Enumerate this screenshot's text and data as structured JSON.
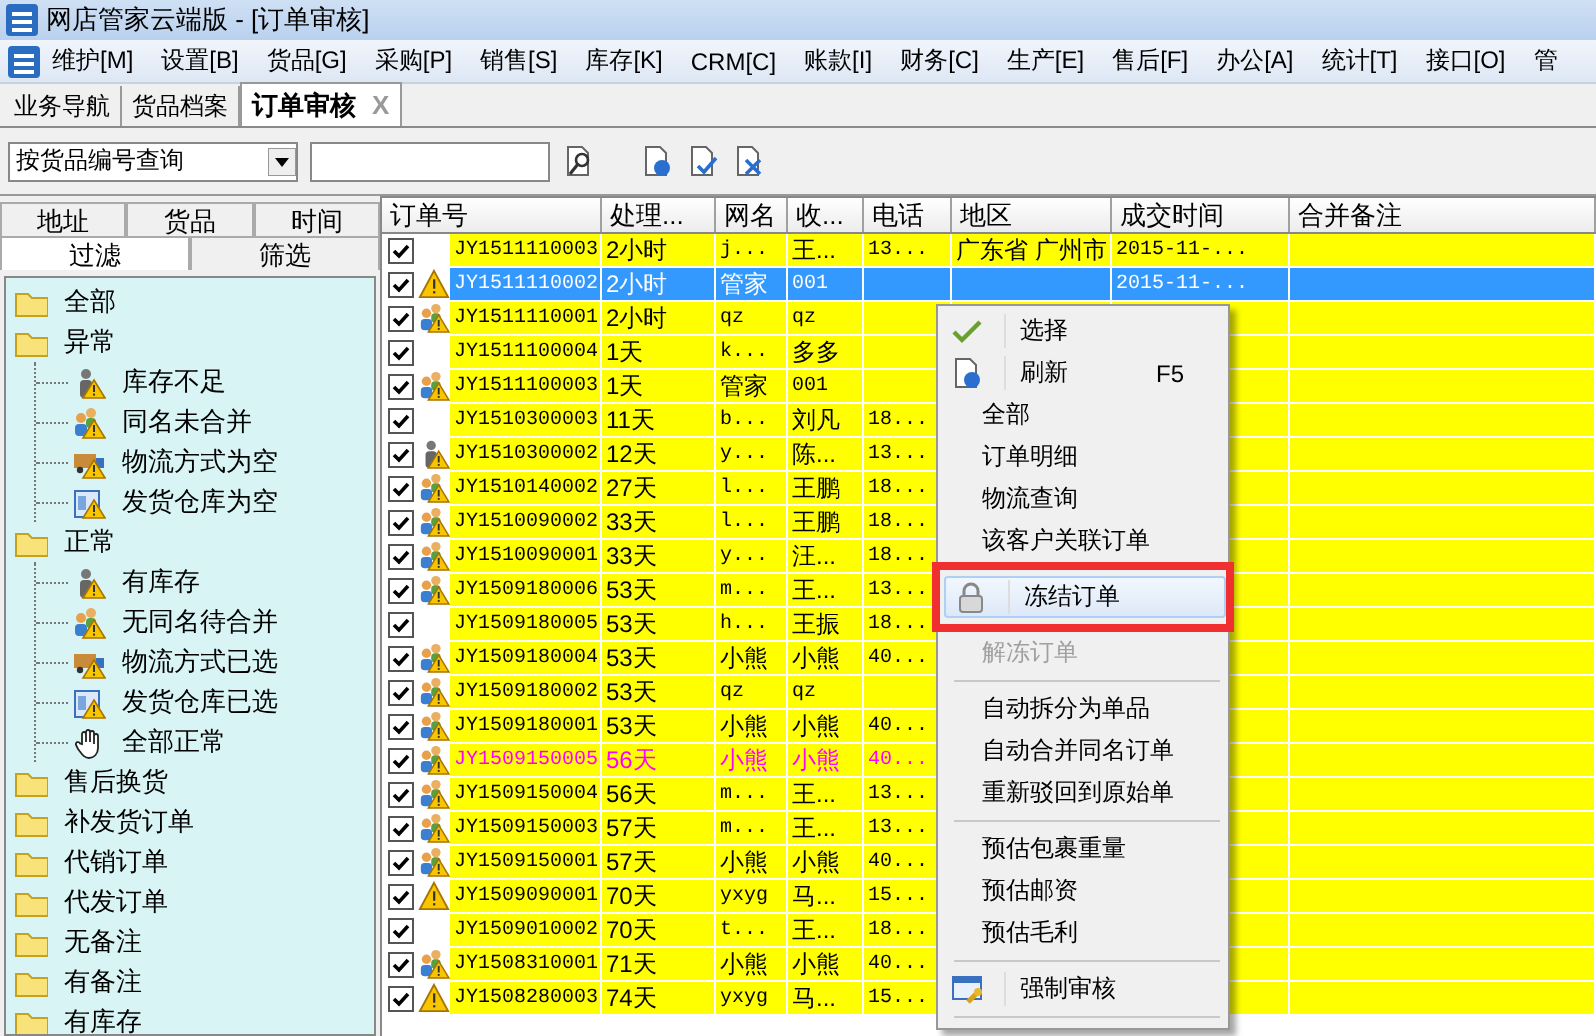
{
  "window": {
    "title": "网店管家云端版 - [订单审核]"
  },
  "menu_bar": [
    "维护[M]",
    "设置[B]",
    "货品[G]",
    "采购[P]",
    "销售[S]",
    "库存[K]",
    "CRM[C]",
    "账款[I]",
    "财务[C]",
    "生产[E]",
    "售后[F]",
    "办公[A]",
    "统计[T]",
    "接口[O]",
    "管"
  ],
  "doc_tabs": [
    {
      "label": "业务导航",
      "selected": false
    },
    {
      "label": "货品档案",
      "selected": false
    },
    {
      "label": "订单审核",
      "selected": true,
      "close": "X"
    }
  ],
  "toolbar": {
    "query_mode": "按货品编号查询"
  },
  "filter_panel": {
    "tab_rows": [
      [
        {
          "label": "地址",
          "selected": false
        },
        {
          "label": "货品",
          "selected": false
        },
        {
          "label": "时间",
          "selected": false
        }
      ],
      [
        {
          "label": "过滤",
          "selected": true
        },
        {
          "label": "筛选",
          "selected": false
        }
      ]
    ],
    "tree": [
      {
        "label": "全部",
        "kind": "folder"
      },
      {
        "label": "异常",
        "kind": "folder",
        "children": [
          {
            "label": "库存不足",
            "kind": "stock"
          },
          {
            "label": "同名未合并",
            "kind": "people"
          },
          {
            "label": "物流方式为空",
            "kind": "truck"
          },
          {
            "label": "发货仓库为空",
            "kind": "warehouse"
          }
        ]
      },
      {
        "label": "正常",
        "kind": "folder",
        "children": [
          {
            "label": "有库存",
            "kind": "stock"
          },
          {
            "label": "无同名待合并",
            "kind": "people"
          },
          {
            "label": "物流方式已选",
            "kind": "truck"
          },
          {
            "label": "发货仓库已选",
            "kind": "warehouse"
          },
          {
            "label": "全部正常",
            "kind": "hand"
          }
        ]
      },
      {
        "label": "售后换货",
        "kind": "folder"
      },
      {
        "label": "补发货订单",
        "kind": "folder"
      },
      {
        "label": "代销订单",
        "kind": "folder"
      },
      {
        "label": "代发订单",
        "kind": "folder"
      },
      {
        "label": "无备注",
        "kind": "folder"
      },
      {
        "label": "有备注",
        "kind": "folder"
      },
      {
        "label": "有库存",
        "kind": "folder"
      }
    ]
  },
  "grid": {
    "columns": [
      "订单号",
      "处理...",
      "网名",
      "收...",
      "电话",
      "地区",
      "成交时间",
      "合并备注"
    ],
    "rows": [
      {
        "checked": true,
        "kind": "plain",
        "order_no": "JY1511110003",
        "wait": "2小时",
        "nick": "j...",
        "receiver": "王...",
        "phone": "13...",
        "region": "广东省 广州市",
        "deal_time": "2015-11-...",
        "selected": false,
        "flagged": false
      },
      {
        "checked": true,
        "kind": "warning",
        "order_no": "JY1511110002",
        "wait": "2小时",
        "nick": "管家",
        "receiver": "001",
        "deal_time": "2015-11-...",
        "selected": true,
        "flagged": false
      },
      {
        "checked": true,
        "kind": "people",
        "order_no": "JY1511110001",
        "wait": "2小时",
        "nick": "qz",
        "receiver": "qz",
        "selected": false,
        "flagged": false
      },
      {
        "checked": true,
        "kind": "plain",
        "order_no": "JY1511100004",
        "wait": "1天",
        "nick": "k...",
        "receiver": "多多",
        "selected": false,
        "flagged": false
      },
      {
        "checked": true,
        "kind": "people",
        "order_no": "JY1511100003",
        "wait": "1天",
        "nick": "管家",
        "receiver": "001",
        "selected": false,
        "flagged": false
      },
      {
        "checked": true,
        "kind": "plain",
        "order_no": "JY1510300003",
        "wait": "11天",
        "nick": "b...",
        "receiver": "刘凡",
        "phone": "18...",
        "selected": false,
        "flagged": false
      },
      {
        "checked": true,
        "kind": "stock",
        "order_no": "JY1510300002",
        "wait": "12天",
        "nick": "y...",
        "receiver": "陈...",
        "phone": "13...",
        "selected": false,
        "flagged": false
      },
      {
        "checked": true,
        "kind": "people",
        "order_no": "JY1510140002",
        "wait": "27天",
        "nick": "l...",
        "receiver": "王鹏",
        "phone": "18...",
        "selected": false,
        "flagged": false
      },
      {
        "checked": true,
        "kind": "people",
        "order_no": "JY1510090002",
        "wait": "33天",
        "nick": "l...",
        "receiver": "王鹏",
        "phone": "18...",
        "selected": false,
        "flagged": false
      },
      {
        "checked": true,
        "kind": "people",
        "order_no": "JY1510090001",
        "wait": "33天",
        "nick": "y...",
        "receiver": "汪...",
        "phone": "18...",
        "selected": false,
        "flagged": false
      },
      {
        "checked": true,
        "kind": "people",
        "order_no": "JY1509180006",
        "wait": "53天",
        "nick": "m...",
        "receiver": "王...",
        "phone": "13...",
        "selected": false,
        "flagged": false
      },
      {
        "checked": true,
        "kind": "plain",
        "order_no": "JY1509180005",
        "wait": "53天",
        "nick": "h...",
        "receiver": "王振",
        "phone": "18...",
        "selected": false,
        "flagged": false
      },
      {
        "checked": true,
        "kind": "people",
        "order_no": "JY1509180004",
        "wait": "53天",
        "nick": "小熊",
        "receiver": "小熊",
        "phone": "40...",
        "selected": false,
        "flagged": false
      },
      {
        "checked": true,
        "kind": "people",
        "order_no": "JY1509180002",
        "wait": "53天",
        "nick": "qz",
        "receiver": "qz",
        "selected": false,
        "flagged": false
      },
      {
        "checked": true,
        "kind": "people",
        "order_no": "JY1509180001",
        "wait": "53天",
        "nick": "小熊",
        "receiver": "小熊",
        "phone": "40...",
        "selected": false,
        "flagged": false
      },
      {
        "checked": true,
        "kind": "people",
        "order_no": "JY1509150005",
        "wait": "56天",
        "nick": "小熊",
        "receiver": "小熊",
        "phone": "40...",
        "selected": false,
        "flagged": true
      },
      {
        "checked": true,
        "kind": "people",
        "order_no": "JY1509150004",
        "wait": "56天",
        "nick": "m...",
        "receiver": "王...",
        "phone": "13...",
        "selected": false,
        "flagged": false
      },
      {
        "checked": true,
        "kind": "people",
        "order_no": "JY1509150003",
        "wait": "57天",
        "nick": "m...",
        "receiver": "王...",
        "phone": "13...",
        "selected": false,
        "flagged": false
      },
      {
        "checked": true,
        "kind": "people",
        "order_no": "JY1509150001",
        "wait": "57天",
        "nick": "小熊",
        "receiver": "小熊",
        "phone": "40...",
        "selected": false,
        "flagged": false
      },
      {
        "checked": true,
        "kind": "warning",
        "order_no": "JY1509090001",
        "wait": "70天",
        "nick": "yxyg",
        "receiver": "马...",
        "phone": "15...",
        "selected": false,
        "flagged": false
      },
      {
        "checked": true,
        "kind": "plain",
        "order_no": "JY1509010002",
        "wait": "70天",
        "nick": "t...",
        "receiver": "王...",
        "phone": "18...",
        "selected": false,
        "flagged": false
      },
      {
        "checked": true,
        "kind": "people",
        "order_no": "JY1508310001",
        "wait": "71天",
        "nick": "小熊",
        "receiver": "小熊",
        "phone": "40...",
        "selected": false,
        "flagged": false
      },
      {
        "checked": true,
        "kind": "warning",
        "order_no": "JY1508280003",
        "wait": "74天",
        "nick": "yxyg",
        "receiver": "马...",
        "phone": "15...",
        "selected": false,
        "flagged": false
      }
    ]
  },
  "context_menu": {
    "items": [
      {
        "kind": "check",
        "label": "选择",
        "disabled": false,
        "selected": false,
        "callout": false
      },
      {
        "kind": "refresh",
        "label": "刷新",
        "shortcut": "F5",
        "disabled": false,
        "selected": false,
        "callout": false
      },
      {
        "kind": "plain",
        "label": "全部",
        "disabled": false,
        "selected": false,
        "callout": false
      },
      {
        "kind": "plain",
        "label": "订单明细",
        "disabled": false,
        "selected": false,
        "callout": false
      },
      {
        "kind": "plain",
        "label": "物流查询",
        "disabled": false,
        "selected": false,
        "callout": false
      },
      {
        "kind": "plain",
        "label": "该客户关联订单",
        "disabled": false,
        "selected": false,
        "callout": false
      },
      {
        "kind": "lock",
        "label": "冻结订单",
        "disabled": false,
        "selected": true,
        "callout": true
      },
      {
        "kind": "plain",
        "label": "解冻订单",
        "disabled": true,
        "selected": false,
        "callout": false
      },
      {
        "kind": "separator"
      },
      {
        "kind": "plain",
        "label": "自动拆分为单品",
        "disabled": false,
        "selected": false,
        "callout": false
      },
      {
        "kind": "plain",
        "label": "自动合并同名订单",
        "disabled": false,
        "selected": false,
        "callout": false
      },
      {
        "kind": "plain",
        "label": "重新驳回到原始单",
        "disabled": false,
        "selected": false,
        "callout": false
      },
      {
        "kind": "separator"
      },
      {
        "kind": "plain",
        "label": "预估包裹重量",
        "disabled": false,
        "selected": false,
        "callout": false
      },
      {
        "kind": "plain",
        "label": "预估邮资",
        "disabled": false,
        "selected": false,
        "callout": false
      },
      {
        "kind": "plain",
        "label": "预估毛利",
        "disabled": false,
        "selected": false,
        "callout": false
      },
      {
        "kind": "separator"
      },
      {
        "kind": "approve",
        "label": "强制审核",
        "disabled": false,
        "selected": false,
        "callout": false
      },
      {
        "kind": "separator"
      }
    ]
  }
}
